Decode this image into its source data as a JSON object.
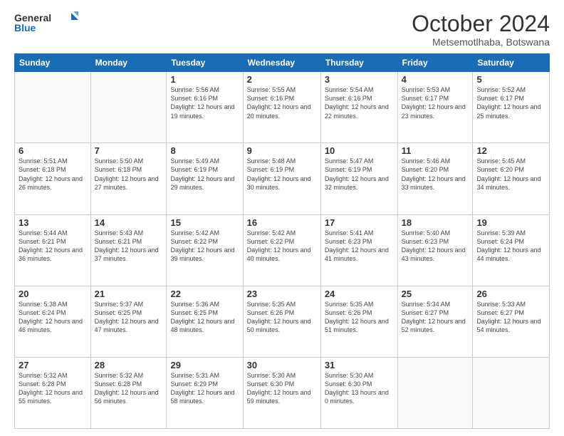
{
  "logo": {
    "line1": "General",
    "line2": "Blue"
  },
  "title": "October 2024",
  "location": "Metsemotlhaba, Botswana",
  "weekdays": [
    "Sunday",
    "Monday",
    "Tuesday",
    "Wednesday",
    "Thursday",
    "Friday",
    "Saturday"
  ],
  "weeks": [
    [
      {
        "day": "",
        "info": ""
      },
      {
        "day": "",
        "info": ""
      },
      {
        "day": "1",
        "info": "Sunrise: 5:56 AM\nSunset: 6:16 PM\nDaylight: 12 hours and 19 minutes."
      },
      {
        "day": "2",
        "info": "Sunrise: 5:55 AM\nSunset: 6:16 PM\nDaylight: 12 hours and 20 minutes."
      },
      {
        "day": "3",
        "info": "Sunrise: 5:54 AM\nSunset: 6:16 PM\nDaylight: 12 hours and 22 minutes."
      },
      {
        "day": "4",
        "info": "Sunrise: 5:53 AM\nSunset: 6:17 PM\nDaylight: 12 hours and 23 minutes."
      },
      {
        "day": "5",
        "info": "Sunrise: 5:52 AM\nSunset: 6:17 PM\nDaylight: 12 hours and 25 minutes."
      }
    ],
    [
      {
        "day": "6",
        "info": "Sunrise: 5:51 AM\nSunset: 6:18 PM\nDaylight: 12 hours and 26 minutes."
      },
      {
        "day": "7",
        "info": "Sunrise: 5:50 AM\nSunset: 6:18 PM\nDaylight: 12 hours and 27 minutes."
      },
      {
        "day": "8",
        "info": "Sunrise: 5:49 AM\nSunset: 6:19 PM\nDaylight: 12 hours and 29 minutes."
      },
      {
        "day": "9",
        "info": "Sunrise: 5:48 AM\nSunset: 6:19 PM\nDaylight: 12 hours and 30 minutes."
      },
      {
        "day": "10",
        "info": "Sunrise: 5:47 AM\nSunset: 6:19 PM\nDaylight: 12 hours and 32 minutes."
      },
      {
        "day": "11",
        "info": "Sunrise: 5:46 AM\nSunset: 6:20 PM\nDaylight: 12 hours and 33 minutes."
      },
      {
        "day": "12",
        "info": "Sunrise: 5:45 AM\nSunset: 6:20 PM\nDaylight: 12 hours and 34 minutes."
      }
    ],
    [
      {
        "day": "13",
        "info": "Sunrise: 5:44 AM\nSunset: 6:21 PM\nDaylight: 12 hours and 36 minutes."
      },
      {
        "day": "14",
        "info": "Sunrise: 5:43 AM\nSunset: 6:21 PM\nDaylight: 12 hours and 37 minutes."
      },
      {
        "day": "15",
        "info": "Sunrise: 5:42 AM\nSunset: 6:22 PM\nDaylight: 12 hours and 39 minutes."
      },
      {
        "day": "16",
        "info": "Sunrise: 5:42 AM\nSunset: 6:22 PM\nDaylight: 12 hours and 40 minutes."
      },
      {
        "day": "17",
        "info": "Sunrise: 5:41 AM\nSunset: 6:23 PM\nDaylight: 12 hours and 41 minutes."
      },
      {
        "day": "18",
        "info": "Sunrise: 5:40 AM\nSunset: 6:23 PM\nDaylight: 12 hours and 43 minutes."
      },
      {
        "day": "19",
        "info": "Sunrise: 5:39 AM\nSunset: 6:24 PM\nDaylight: 12 hours and 44 minutes."
      }
    ],
    [
      {
        "day": "20",
        "info": "Sunrise: 5:38 AM\nSunset: 6:24 PM\nDaylight: 12 hours and 46 minutes."
      },
      {
        "day": "21",
        "info": "Sunrise: 5:37 AM\nSunset: 6:25 PM\nDaylight: 12 hours and 47 minutes."
      },
      {
        "day": "22",
        "info": "Sunrise: 5:36 AM\nSunset: 6:25 PM\nDaylight: 12 hours and 48 minutes."
      },
      {
        "day": "23",
        "info": "Sunrise: 5:35 AM\nSunset: 6:26 PM\nDaylight: 12 hours and 50 minutes."
      },
      {
        "day": "24",
        "info": "Sunrise: 5:35 AM\nSunset: 6:26 PM\nDaylight: 12 hours and 51 minutes."
      },
      {
        "day": "25",
        "info": "Sunrise: 5:34 AM\nSunset: 6:27 PM\nDaylight: 12 hours and 52 minutes."
      },
      {
        "day": "26",
        "info": "Sunrise: 5:33 AM\nSunset: 6:27 PM\nDaylight: 12 hours and 54 minutes."
      }
    ],
    [
      {
        "day": "27",
        "info": "Sunrise: 5:32 AM\nSunset: 6:28 PM\nDaylight: 12 hours and 55 minutes."
      },
      {
        "day": "28",
        "info": "Sunrise: 5:32 AM\nSunset: 6:28 PM\nDaylight: 12 hours and 56 minutes."
      },
      {
        "day": "29",
        "info": "Sunrise: 5:31 AM\nSunset: 6:29 PM\nDaylight: 12 hours and 58 minutes."
      },
      {
        "day": "30",
        "info": "Sunrise: 5:30 AM\nSunset: 6:30 PM\nDaylight: 12 hours and 59 minutes."
      },
      {
        "day": "31",
        "info": "Sunrise: 5:30 AM\nSunset: 6:30 PM\nDaylight: 13 hours and 0 minutes."
      },
      {
        "day": "",
        "info": ""
      },
      {
        "day": "",
        "info": ""
      }
    ]
  ]
}
